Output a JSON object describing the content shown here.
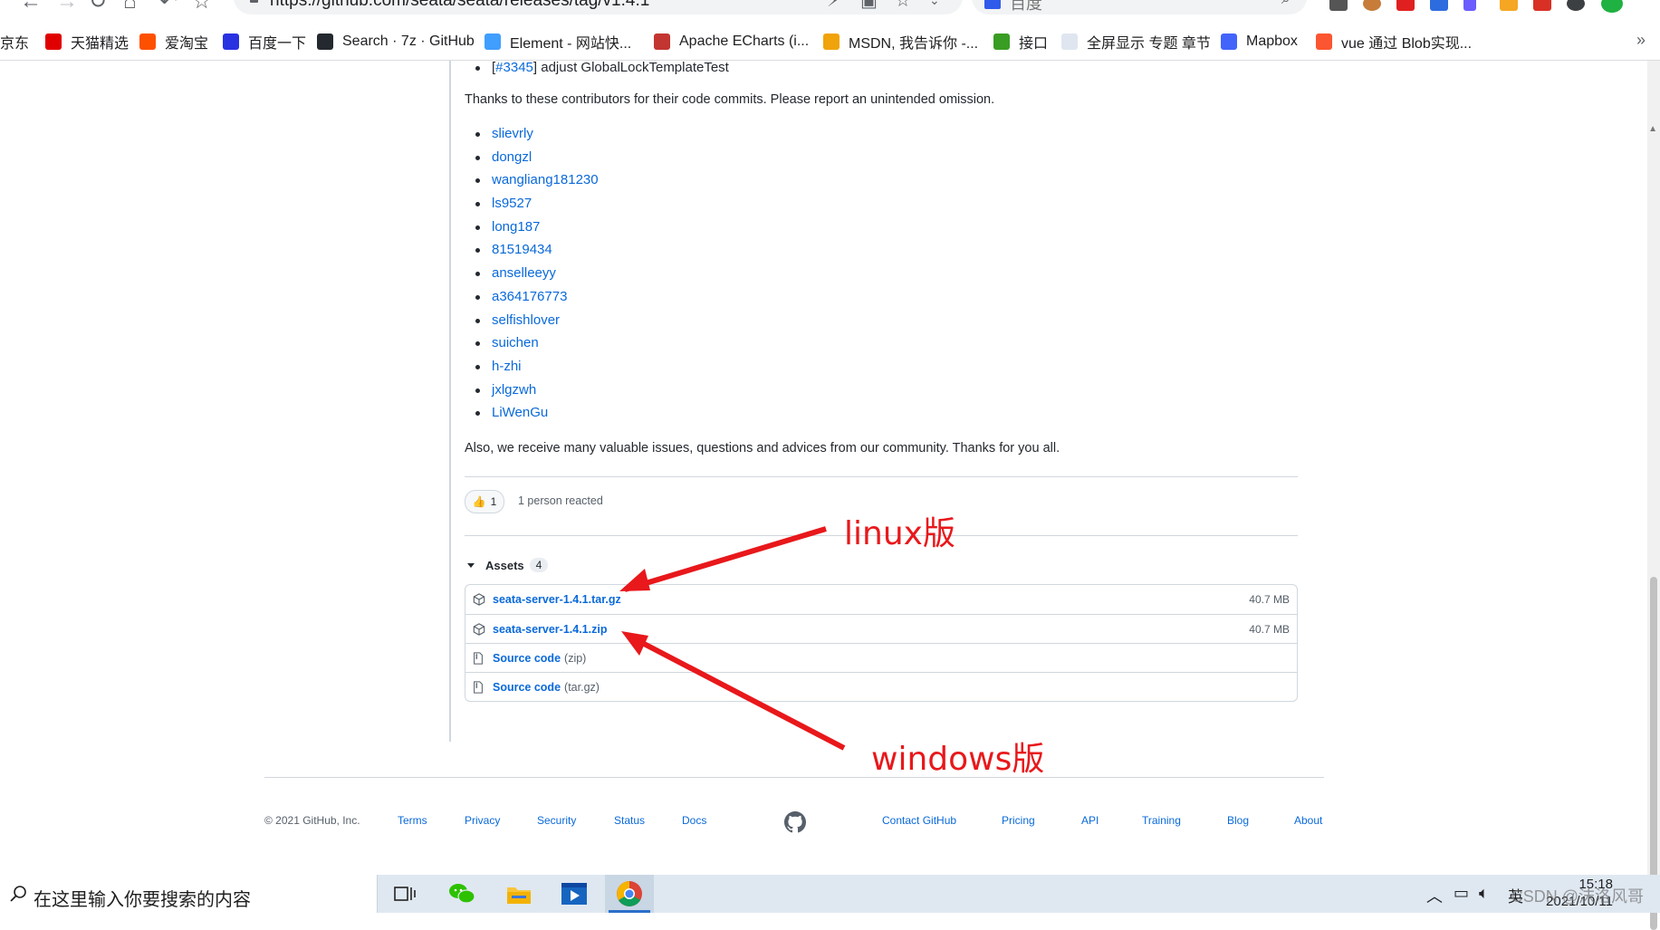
{
  "browser": {
    "url": "https://github.com/seata/seata/releases/tag/v1.4.1",
    "search_placeholder": "百度",
    "bookmarks": [
      {
        "label": "京东",
        "icon": "jd-icon",
        "color": "#e1251b"
      },
      {
        "label": "天猫精选",
        "icon": "tmall-icon",
        "color": "#e00000"
      },
      {
        "label": "爱淘宝",
        "icon": "taobao-icon",
        "color": "#ff5000"
      },
      {
        "label": "百度一下",
        "icon": "baidu-paw-icon",
        "color": "#2932e1"
      },
      {
        "label": "Search · 7z · GitHub",
        "icon": "github-icon",
        "color": "#24292f"
      },
      {
        "label": "Element - 网站快...",
        "icon": "element-icon",
        "color": "#409eff"
      },
      {
        "label": "Apache ECharts (i...",
        "icon": "echarts-icon",
        "color": "#c23531"
      },
      {
        "label": "MSDN, 我告诉你 -...",
        "icon": "msdn-icon",
        "color": "#f0a30a"
      },
      {
        "label": "接口",
        "icon": "api-icon",
        "color": "#3a9d23"
      },
      {
        "label": "全屏显示 专题 章节",
        "icon": "page-icon",
        "color": "#dfe6f0"
      },
      {
        "label": "Mapbox",
        "icon": "mapbox-icon",
        "color": "#4264fb"
      },
      {
        "label": "vue 通过 Blob实现...",
        "icon": "csdn-icon",
        "color": "#fc5531"
      }
    ],
    "more_label": "»"
  },
  "release": {
    "last_change_ref": "#3345",
    "last_change_text": "adjust GlobalLockTemplateTest",
    "contributors_intro": "Thanks to these contributors for their code commits. Please report an unintended omission.",
    "contributors": [
      "slievrly",
      "dongzl",
      "wangliang181230",
      "ls9527",
      "long187",
      "81519434",
      "anselleeyy",
      "a364176773",
      "selfishlover",
      "suichen",
      "h-zhi",
      "jxlgzwh",
      "LiWenGu"
    ],
    "community_thanks": "Also, we receive many valuable issues, questions and advices from our community. Thanks for you all.",
    "reaction_emoji": "👍",
    "reaction_count": "1",
    "reaction_text": "1 person reacted",
    "assets_label": "Assets",
    "assets_count": "4",
    "assets": [
      {
        "name": "seata-server-1.4.1.tar.gz",
        "suffix": "",
        "size": "40.7 MB",
        "icon": "package-icon"
      },
      {
        "name": "seata-server-1.4.1.zip",
        "suffix": "",
        "size": "40.7 MB",
        "icon": "package-icon"
      },
      {
        "name": "Source code",
        "suffix": "(zip)",
        "size": "",
        "icon": "file-zip-icon"
      },
      {
        "name": "Source code",
        "suffix": "(tar.gz)",
        "size": "",
        "icon": "file-zip-icon"
      }
    ]
  },
  "annotations": {
    "linux_label": "linux版",
    "windows_label": "windows版",
    "color": "#e8181b"
  },
  "footer": {
    "copyright": "© 2021 GitHub, Inc.",
    "links_left": [
      "Terms",
      "Privacy",
      "Security",
      "Status",
      "Docs"
    ],
    "links_right": [
      "Contact GitHub",
      "Pricing",
      "API",
      "Training",
      "Blog",
      "About"
    ]
  },
  "taskbar": {
    "search_placeholder": "在这里输入你要搜索的内容",
    "apps": [
      "task-view-icon",
      "wechat-icon",
      "file-explorer-icon",
      "media-player-icon",
      "chrome-icon"
    ],
    "ime": "英",
    "time": "15:18",
    "date": "2021/10/11",
    "watermark": "CSDN @沫洛风哥"
  }
}
